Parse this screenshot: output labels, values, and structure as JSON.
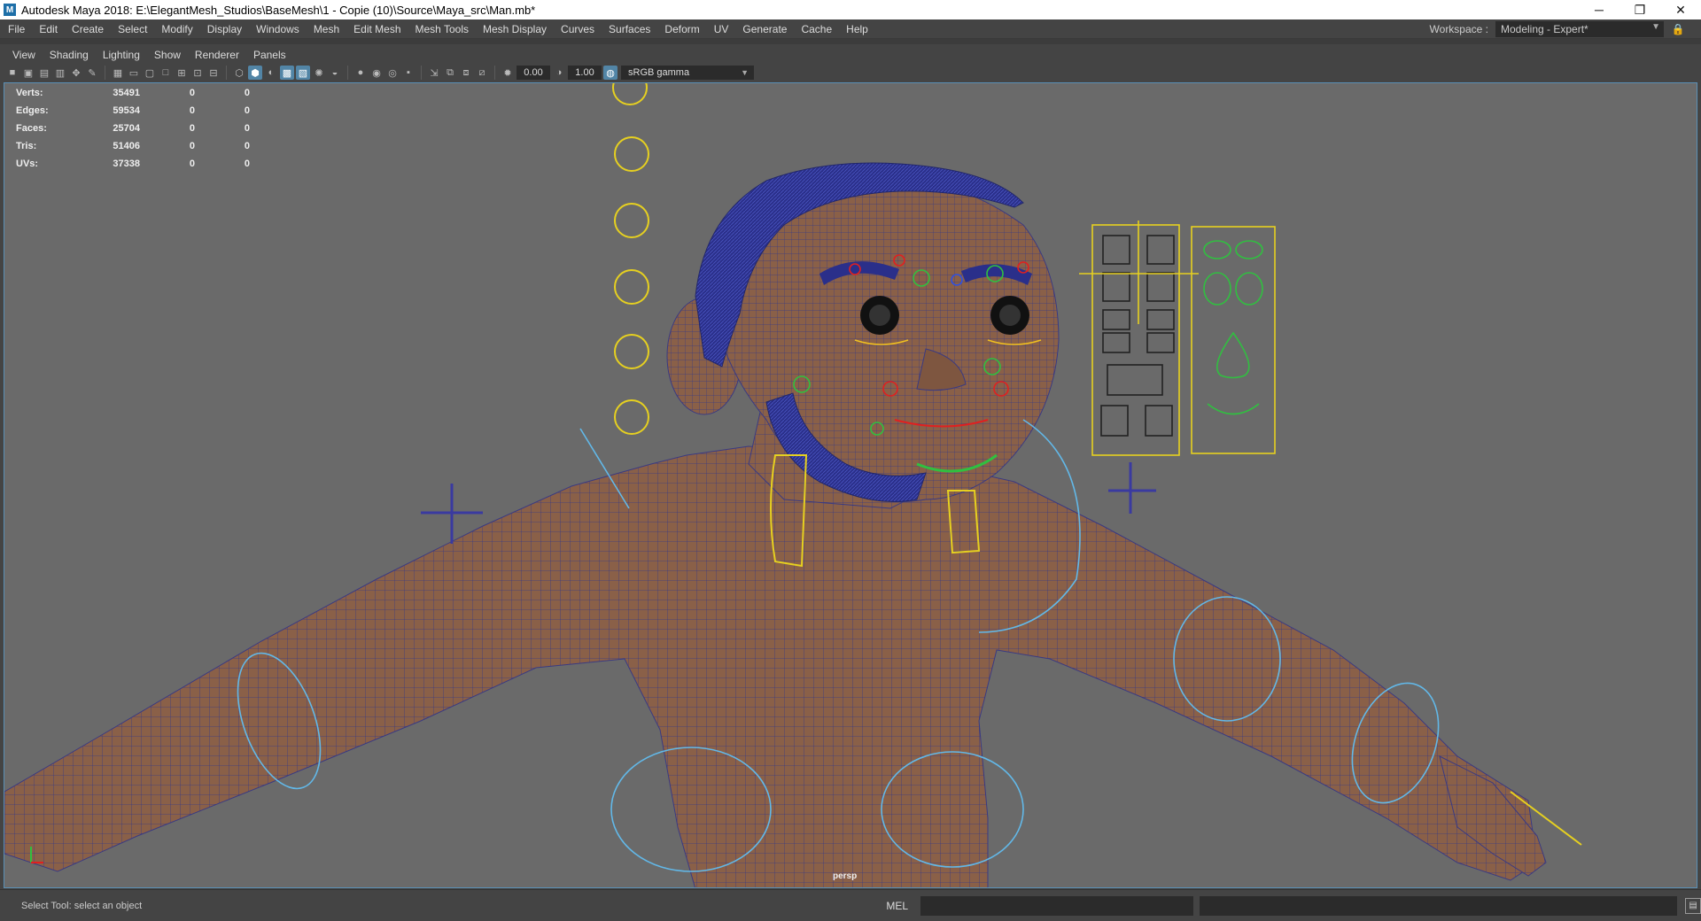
{
  "window": {
    "title": "Autodesk Maya 2018: E:\\ElegantMesh_Studios\\BaseMesh\\1 - Copie (10)\\Source\\Maya_src\\Man.mb*",
    "app_icon": "M",
    "minimize": "─",
    "restore": "❐",
    "close": "✕"
  },
  "menu": [
    "File",
    "Edit",
    "Create",
    "Select",
    "Modify",
    "Display",
    "Windows",
    "Mesh",
    "Edit Mesh",
    "Mesh Tools",
    "Mesh Display",
    "Curves",
    "Surfaces",
    "Deform",
    "UV",
    "Generate",
    "Cache",
    "Help"
  ],
  "workspace": {
    "label": "Workspace :",
    "value": "Modeling - Expert*",
    "lock_icon": "🔒"
  },
  "panel_menu": [
    "View",
    "Shading",
    "Lighting",
    "Show",
    "Renderer",
    "Panels"
  ],
  "toolbar": {
    "exposure": "0.00",
    "gamma": "1.00",
    "color_space": "sRGB gamma"
  },
  "hud": {
    "rows": [
      {
        "label": "Verts:",
        "value": "35491",
        "a": "0",
        "b": "0"
      },
      {
        "label": "Edges:",
        "value": "59534",
        "a": "0",
        "b": "0"
      },
      {
        "label": "Faces:",
        "value": "25704",
        "a": "0",
        "b": "0"
      },
      {
        "label": "Tris:",
        "value": "51406",
        "a": "0",
        "b": "0"
      },
      {
        "label": "UVs:",
        "value": "37338",
        "a": "0",
        "b": "0"
      }
    ]
  },
  "camera": "persp",
  "status": {
    "help": "Select Tool: select an object",
    "mel": "MEL"
  }
}
